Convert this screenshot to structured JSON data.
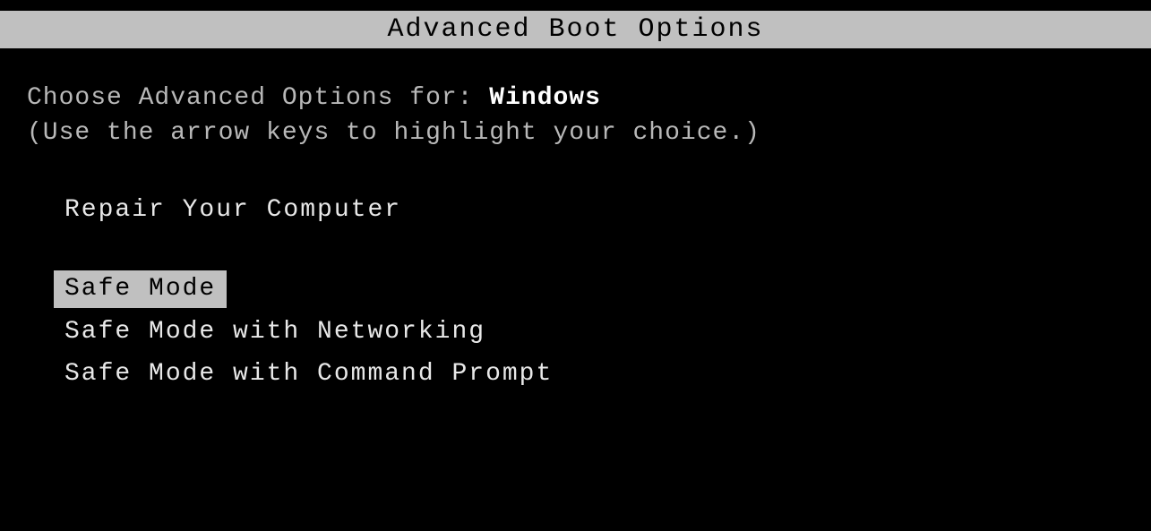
{
  "title": "Advanced Boot Options",
  "prompt": {
    "label": "Choose Advanced Options for: ",
    "os": "Windows"
  },
  "hint": "(Use the arrow keys to highlight your choice.)",
  "menu": {
    "items": [
      {
        "label": "Repair Your Computer",
        "selected": false
      },
      {
        "label": "Safe Mode",
        "selected": true
      },
      {
        "label": "Safe Mode with Networking",
        "selected": false
      },
      {
        "label": "Safe Mode with Command Prompt",
        "selected": false
      }
    ]
  }
}
